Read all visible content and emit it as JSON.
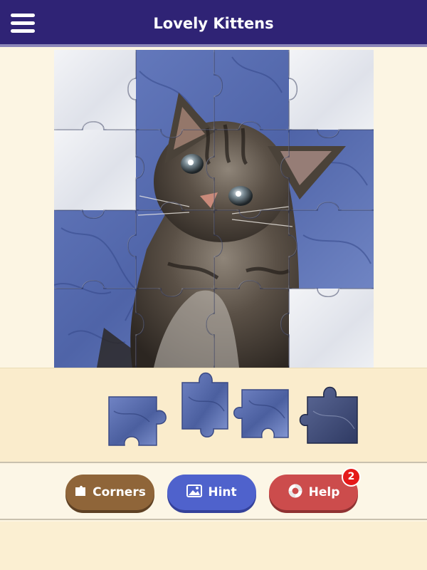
{
  "header": {
    "title": "Lovely Kittens",
    "menu_icon": "hamburger-menu-icon",
    "background_color": "#2f2375"
  },
  "puzzle": {
    "grid": {
      "columns": 4,
      "rows": 4
    },
    "placed_pieces_count": 12,
    "empty_slots_count": 4,
    "image_subject": "tabby kitten on blue marbled background",
    "colors": {
      "marble_blue": "#5b6fb0",
      "marble_white": "#e9ecf2",
      "kitten_dark": "#3d362f",
      "kitten_light": "#c9c3bb",
      "empty_slot": "#eef0f4"
    }
  },
  "tray": {
    "pieces_count": 4,
    "background_color": "#faeccc"
  },
  "buttons": {
    "corners": {
      "label": "Corners",
      "icon": "puzzle-corner-icon",
      "color": "#8f6539"
    },
    "hint": {
      "label": "Hint",
      "icon": "image-icon",
      "color": "#4f62cc"
    },
    "help": {
      "label": "Help",
      "icon": "lifebuoy-icon",
      "color": "#cc4c4c",
      "badge": "2"
    }
  }
}
